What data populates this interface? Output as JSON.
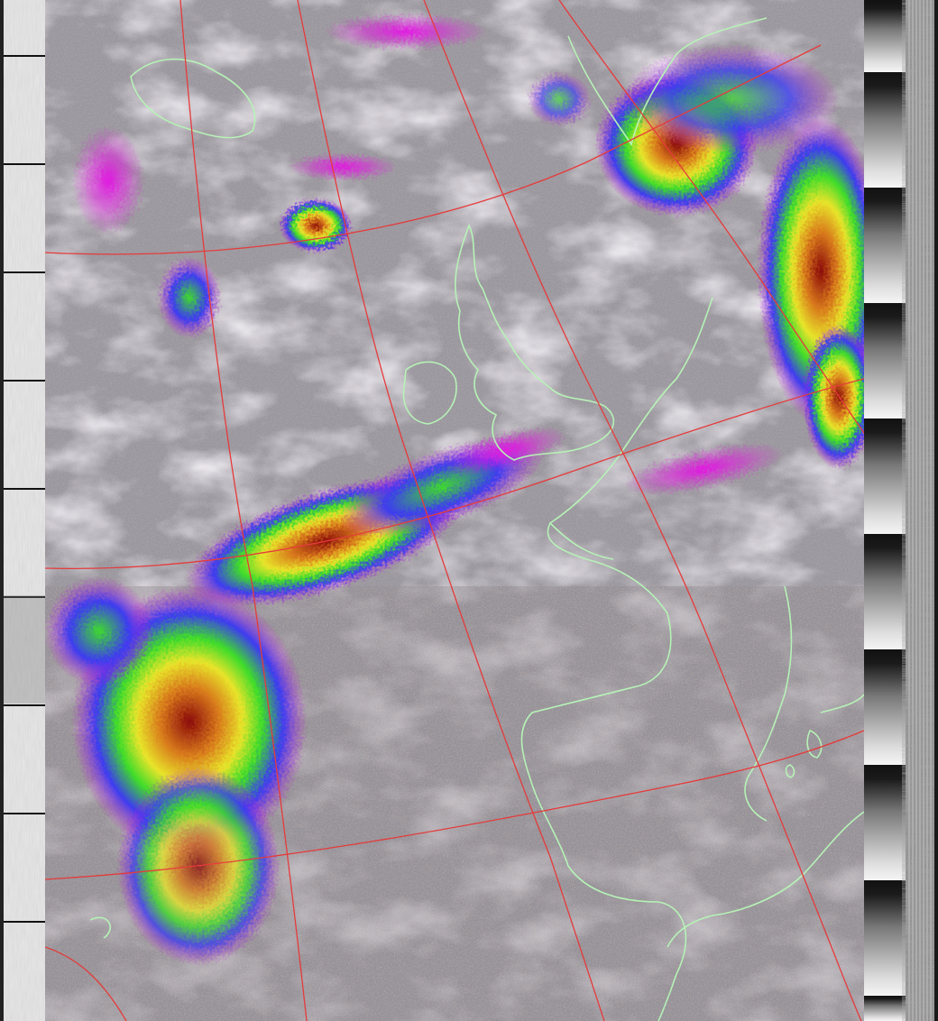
{
  "image": {
    "kind": "false-color APT satellite image (NOAA) with map overlay",
    "colors": {
      "background_gray": "#9a969d",
      "cloud_light": "#e6dfea",
      "cloud_mid": "#bdb6c3",
      "coastline": "#b6f2b6",
      "graticule": "#e53b3b",
      "magenta": "#d11ad4",
      "blue": "#3c3cf0",
      "green": "#3fdc2a",
      "yellow": "#e8e42a",
      "orange": "#d87a1c",
      "red": "#b01010",
      "noise_orange": "#e2a468"
    }
  }
}
